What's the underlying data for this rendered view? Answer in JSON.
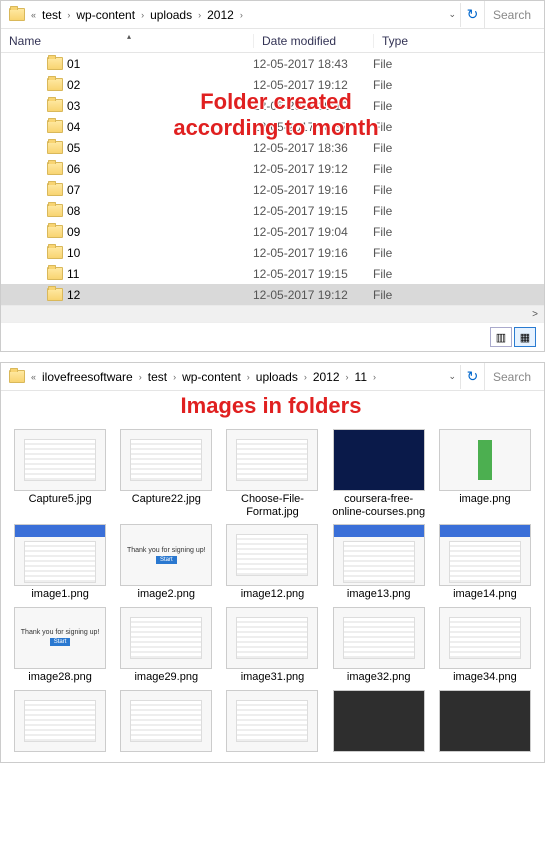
{
  "top": {
    "breadcrumb": [
      "test",
      "wp-content",
      "uploads",
      "2012"
    ],
    "search": "Search",
    "columns": {
      "name": "Name",
      "date": "Date modified",
      "type": "Type"
    },
    "rows": [
      {
        "name": "01",
        "date": "12-05-2017 18:43",
        "type": "File",
        "sel": false
      },
      {
        "name": "02",
        "date": "12-05-2017 19:12",
        "type": "File",
        "sel": false
      },
      {
        "name": "03",
        "date": "12-05-2017 19:12",
        "type": "File",
        "sel": false
      },
      {
        "name": "04",
        "date": "12-05-2017 18:37",
        "type": "File",
        "sel": false
      },
      {
        "name": "05",
        "date": "12-05-2017 18:36",
        "type": "File",
        "sel": false
      },
      {
        "name": "06",
        "date": "12-05-2017 19:12",
        "type": "File",
        "sel": false
      },
      {
        "name": "07",
        "date": "12-05-2017 19:16",
        "type": "File",
        "sel": false
      },
      {
        "name": "08",
        "date": "12-05-2017 19:15",
        "type": "File",
        "sel": false
      },
      {
        "name": "09",
        "date": "12-05-2017 19:04",
        "type": "File",
        "sel": false
      },
      {
        "name": "10",
        "date": "12-05-2017 19:16",
        "type": "File",
        "sel": false
      },
      {
        "name": "11",
        "date": "12-05-2017 19:15",
        "type": "File",
        "sel": false
      },
      {
        "name": "12",
        "date": "12-05-2017 19:12",
        "type": "File",
        "sel": true
      }
    ],
    "annotation": "Folder created\naccording to month"
  },
  "bottom": {
    "breadcrumb": [
      "ilovefreesoftware",
      "test",
      "wp-content",
      "uploads",
      "2012",
      "11"
    ],
    "search": "Search",
    "annotation": "Images in folders",
    "thumbs": [
      {
        "label": "Capture5.jpg",
        "style": "lines"
      },
      {
        "label": "Capture22.jpg",
        "style": "lines"
      },
      {
        "label": "Choose-File-Format.jpg",
        "style": "lines"
      },
      {
        "label": "coursera-free-online-courses.png",
        "style": "darkblue"
      },
      {
        "label": "image.png",
        "style": "green"
      },
      {
        "label": "image1.png",
        "style": "bluebar"
      },
      {
        "label": "image2.png",
        "style": "signup"
      },
      {
        "label": "image12.png",
        "style": "lines"
      },
      {
        "label": "image13.png",
        "style": "bluebar"
      },
      {
        "label": "image14.png",
        "style": "bluebar"
      },
      {
        "label": "image28.png",
        "style": "signup"
      },
      {
        "label": "image29.png",
        "style": "lines"
      },
      {
        "label": "image31.png",
        "style": "lines"
      },
      {
        "label": "image32.png",
        "style": "lines"
      },
      {
        "label": "image34.png",
        "style": "lines"
      },
      {
        "label": "",
        "style": "lines"
      },
      {
        "label": "",
        "style": "lines"
      },
      {
        "label": "",
        "style": "lines"
      },
      {
        "label": "",
        "style": "dark2"
      },
      {
        "label": "",
        "style": "dark2"
      }
    ]
  }
}
